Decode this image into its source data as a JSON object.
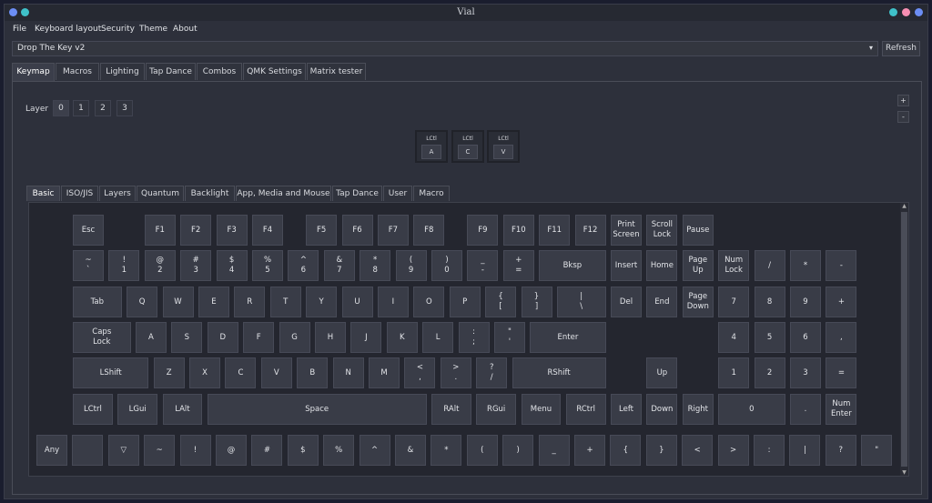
{
  "window": {
    "title": "Vial"
  },
  "menu": [
    "File",
    "Keyboard layout",
    "Security",
    "Theme",
    "About"
  ],
  "device": {
    "selected": "Drop The Key v2",
    "refresh_label": "Refresh"
  },
  "main_tabs": [
    "Keymap",
    "Macros",
    "Lighting",
    "Tap Dance",
    "Combos",
    "QMK Settings",
    "Matrix tester"
  ],
  "layer": {
    "label": "Layer",
    "buttons": [
      "0",
      "1",
      "2",
      "3"
    ]
  },
  "zoom": {
    "plus": "+",
    "minus": "-"
  },
  "combo_keys": [
    {
      "mod": "LCtl",
      "key": "A"
    },
    {
      "mod": "LCtl",
      "key": "C"
    },
    {
      "mod": "LCtl",
      "key": "V"
    }
  ],
  "key_tabs": [
    "Basic",
    "ISO/JIS",
    "Layers",
    "Quantum",
    "Backlight",
    "App, Media and Mouse",
    "Tap Dance",
    "User",
    "Macro"
  ],
  "keys": {
    "row0": [
      "Esc",
      "F1",
      "F2",
      "F3",
      "F4",
      "F5",
      "F6",
      "F7",
      "F8",
      "F9",
      "F10",
      "F11",
      "F12",
      "Print\nScreen",
      "Scroll\nLock",
      "Pause"
    ],
    "row1": [
      "~\n`",
      "!\n1",
      "@\n2",
      "#\n3",
      "$\n4",
      "%\n5",
      "^\n6",
      "&\n7",
      "*\n8",
      "(\n9",
      ")\n0",
      "_\n-",
      "+\n=",
      "Bksp",
      "Insert",
      "Home",
      "Page\nUp",
      "Num\nLock",
      "/",
      "*",
      "-"
    ],
    "row2": [
      "Tab",
      "Q",
      "W",
      "E",
      "R",
      "T",
      "Y",
      "U",
      "I",
      "O",
      "P",
      "{\n[",
      "}\n]",
      "|\n\\",
      "Del",
      "End",
      "Page\nDown",
      "7",
      "8",
      "9",
      "+"
    ],
    "row3": [
      "Caps\nLock",
      "A",
      "S",
      "D",
      "F",
      "G",
      "H",
      "J",
      "K",
      "L",
      ":\n;",
      "\"\n'",
      "Enter",
      "4",
      "5",
      "6",
      ","
    ],
    "row4": [
      "LShift",
      "Z",
      "X",
      "C",
      "V",
      "B",
      "N",
      "M",
      "<\n,",
      ">\n.",
      "?\n/",
      "RShift",
      "Up",
      "1",
      "2",
      "3",
      "="
    ],
    "row5": [
      "LCtrl",
      "LGui",
      "LAlt",
      "Space",
      "RAlt",
      "RGui",
      "Menu",
      "RCtrl",
      "Left",
      "Down",
      "Right",
      "0",
      ".",
      "Num\nEnter"
    ],
    "any_row": [
      "Any",
      "",
      "▽",
      "~",
      "!",
      "@",
      "#",
      "$",
      "%",
      "^",
      "&",
      "*",
      "(",
      ")",
      "_",
      "+",
      "{",
      "}",
      "<",
      ">",
      ":",
      "|",
      "?",
      "\""
    ]
  },
  "colors": {
    "accent_dots": [
      "#3fc1c9",
      "#f78fb3",
      "#6c8ef5"
    ]
  }
}
